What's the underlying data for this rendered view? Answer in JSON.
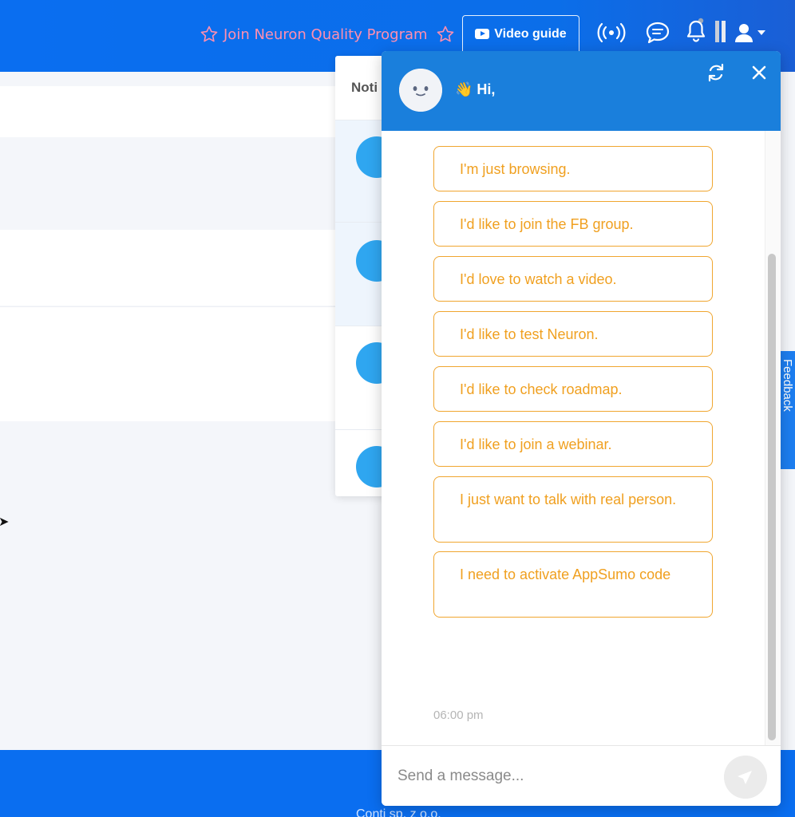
{
  "topbar": {
    "quality_program": "Join Neuron Quality Program",
    "video_guide": "Video guide"
  },
  "notifications": {
    "title": "Noti"
  },
  "chat": {
    "greeting": "👋 Hi,",
    "options": [
      "I'm just browsing.",
      "I'd like to join the FB group.",
      "I'd love to watch a video.",
      "I'd like to test Neuron.",
      "I'd like to check roadmap.",
      "I'd like to join a webinar.",
      "I just want to talk with real person.",
      "I need to activate AppSumo code"
    ],
    "timestamp": "06:00 pm",
    "input_placeholder": "Send a message..."
  },
  "feedback_tab": "Feedback",
  "footer_text": "Conti sp. z o.o.",
  "colors": {
    "brand_blue": "#0a6ef0",
    "chat_header": "#1a7fdc",
    "option_orange": "#f0a630",
    "quality_pink": "#ff8fb0"
  }
}
